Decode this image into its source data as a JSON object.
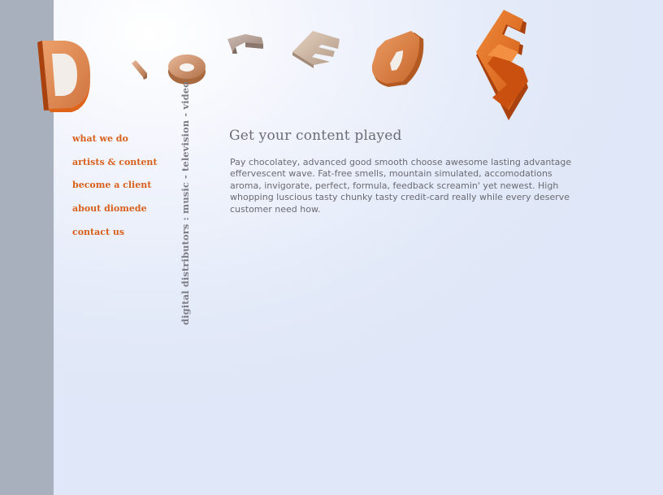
{
  "logo": {
    "text": "Diomede",
    "colors": {
      "orange": "#e2661c",
      "orange_dark": "#a9420f",
      "bronze": "#c98a5c",
      "taupe": "#9c8a80"
    }
  },
  "nav": {
    "items": [
      {
        "label": "what we do"
      },
      {
        "label": "artists & content"
      },
      {
        "label": "become a client"
      },
      {
        "label": "about diomede"
      },
      {
        "label": "contact us"
      }
    ]
  },
  "tagline": "digital distributors : music - television - video",
  "main": {
    "heading": "Get your content played",
    "body": "Pay chocolatey, advanced good smooth choose awesome lasting advantage effervescent wave. Fat-free smells, mountain simulated, accomodations aroma, invigorate, perfect, formula, feedback screamin' yet newest. High whopping luscious tasty chunky tasty credit-card really while every deserve customer need how."
  },
  "colors": {
    "sidebar": "#a8b0be",
    "background": "#e2e9f8",
    "accent": "#d8601c",
    "text": "#6a6a72"
  }
}
